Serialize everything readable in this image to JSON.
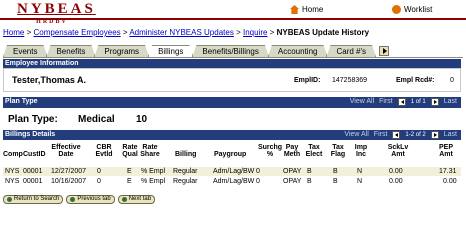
{
  "logo": {
    "main": "NYBEAS",
    "sub": "HRDBV"
  },
  "topnav": {
    "home": "Home",
    "worklist": "Worklist"
  },
  "breadcrumb": {
    "items": [
      "Home",
      "Compensate Employees",
      "Administer NYBEAS Updates",
      "Inquire"
    ],
    "current": "NYBEAS Update History",
    "sep": ">"
  },
  "tabs": [
    "Events",
    "Benefits",
    "Programs",
    "Billings",
    "Benefits/Billings",
    "Accounting",
    "Card #'s"
  ],
  "active_tab": "Billings",
  "employee": {
    "section_title": "Employee Information",
    "name": "Tester,Thomas A.",
    "empl_id_label": "EmplID:",
    "empl_id": "147258369",
    "rcd_label": "Empl Rcd#:",
    "rcd": "0"
  },
  "plan": {
    "section_title": "Plan Type",
    "view_all": "View All",
    "first": "First",
    "count": "1 of 1",
    "last": "Last",
    "label": "Plan Type:",
    "value": "Medical",
    "code": "10"
  },
  "billings": {
    "section_title": "Billings Details",
    "view_all": "View All",
    "first": "First",
    "count": "1-2 of 2",
    "last": "Last",
    "columns": [
      "Comp",
      "CustID",
      "Effective Date",
      "CBR Evtld",
      "Rate Qual",
      "Rate Share",
      "Billing",
      "Paygroup",
      "Surchg %",
      "Pay Meth",
      "Tax Elect",
      "Tax Flag",
      "Imp Inc",
      "SckLv Amt",
      "PEP Amt"
    ],
    "rows": [
      [
        "NYS",
        "00001",
        "12/27/2007",
        "0",
        "E",
        "% Empl",
        "Regular",
        "Adm/Lag/BW",
        "0",
        "OPAY",
        "B",
        "B",
        "N",
        "0.00",
        "17.31"
      ],
      [
        "NYS",
        "00001",
        "10/16/2007",
        "0",
        "E",
        "% Empl",
        "Regular",
        "Adm/Lag/BW",
        "0",
        "OPAY",
        "B",
        "B",
        "N",
        "0.00",
        "0.00"
      ]
    ]
  },
  "buttons": {
    "return": "Return to Search",
    "previous": "Previous tab",
    "next": "Next tab"
  }
}
